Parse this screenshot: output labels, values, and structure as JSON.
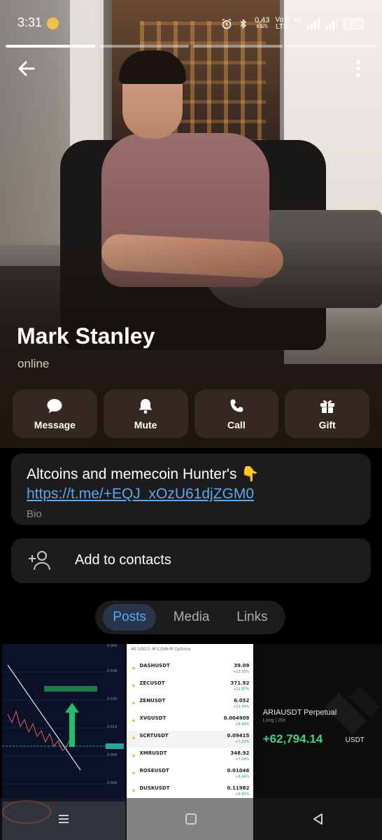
{
  "status_bar": {
    "time": "3:31",
    "net_speed_value": "0.43",
    "net_speed_unit": "KB/S",
    "volte_top": "Vo ll",
    "volte_bottom": "LTE",
    "network_gen": "4G",
    "battery": "25"
  },
  "profile": {
    "name": "Mark Stanley",
    "status": "online"
  },
  "actions": {
    "message": "Message",
    "mute": "Mute",
    "call": "Call",
    "gift": "Gift"
  },
  "bio": {
    "text": "Altcoins and memecoin Hunter's 👇",
    "link": "https://t.me/+EQJ_xOzU61djZGM0",
    "label": "Bio"
  },
  "contact": {
    "label": "Add to contacts"
  },
  "tabs": [
    "Posts",
    "Media",
    "Links"
  ],
  "active_tab": "Posts",
  "posts": {
    "list_header": "All  USDⓈ-M  COIN-M  Options",
    "list_rows": [
      {
        "symbol": "DASHUSDT",
        "price": "39.09",
        "change": "+13.33%"
      },
      {
        "symbol": "ZECUSDT",
        "price": "371.92",
        "change": "+12.97%"
      },
      {
        "symbol": "ZENUSDT",
        "price": "6.052",
        "change": "+12.34%"
      },
      {
        "symbol": "XVGUSDT",
        "price": "0.004909",
        "change": "+8.44%"
      },
      {
        "symbol": "SCRTUSDT",
        "price": "0.09415",
        "change": "+7.22%"
      },
      {
        "symbol": "XMRUSDT",
        "price": "348.92",
        "change": "+7.04%"
      },
      {
        "symbol": "ROSEUSDT",
        "price": "0.01046",
        "change": "+6.94%"
      },
      {
        "symbol": "DUSKUSDT",
        "price": "0.11982",
        "change": "+6.85%"
      }
    ],
    "pnl_title": "ARIAUSDT Perpetual",
    "pnl_sub": "Long  |  20x",
    "pnl_value": "+62,794.14",
    "pnl_unit": "USDT"
  },
  "colors": {
    "accent": "#5aa9ee",
    "card": "#1c1c1e",
    "background": "#000000",
    "profit": "#3fd28a"
  },
  "icons": {
    "back": "arrow-left-icon",
    "more": "more-vertical-icon",
    "message": "chat-bubble-icon",
    "mute": "bell-icon",
    "call": "phone-icon",
    "gift": "gift-icon",
    "add_contact": "add-person-icon"
  }
}
